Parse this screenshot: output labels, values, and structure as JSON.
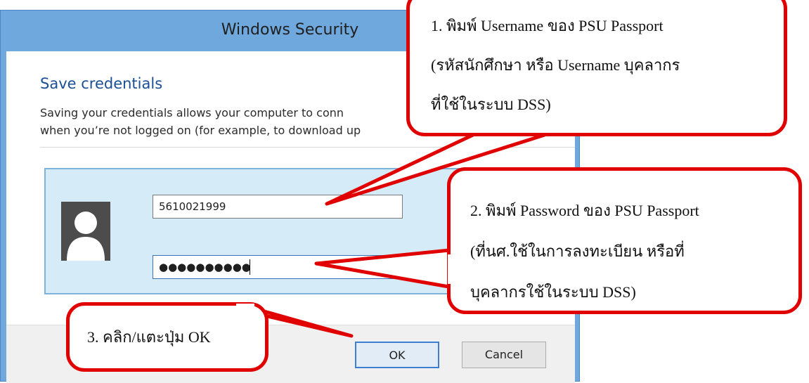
{
  "dialog": {
    "title": "Windows Security",
    "heading": "Save credentials",
    "description_line1": "Saving your credentials allows your computer to conn",
    "description_line2": "when you’re not logged on (for example, to download up",
    "username_value": "5610021999",
    "password_value": "●●●●●●●●●●",
    "ok_label": "OK",
    "cancel_label": "Cancel",
    "avatar_icon": "user-silhouette-icon"
  },
  "callouts": {
    "step1": {
      "line1": "1. พิมพ์ Username ของ PSU Passport",
      "line2": "(รหัสนักศึกษา หรือ Username บุคลากร",
      "line3": "ที่ใช้ในระบบ DSS)"
    },
    "step2": {
      "line1": "2. พิมพ์ Password ของ PSU Passport",
      "line2": "(ที่นศ.ใช้ในการลงทะเบียน หรือที่",
      "line3": "บุคลากรใช้ในระบบ DSS)"
    },
    "step3": {
      "line1": "3. คลิก/แตะปุ่ม OK"
    }
  },
  "colors": {
    "callout_border": "#e00000",
    "window_frame": "#6fa8dc",
    "heading_blue": "#1a4f96",
    "panel_bg": "#d5ebf7"
  }
}
